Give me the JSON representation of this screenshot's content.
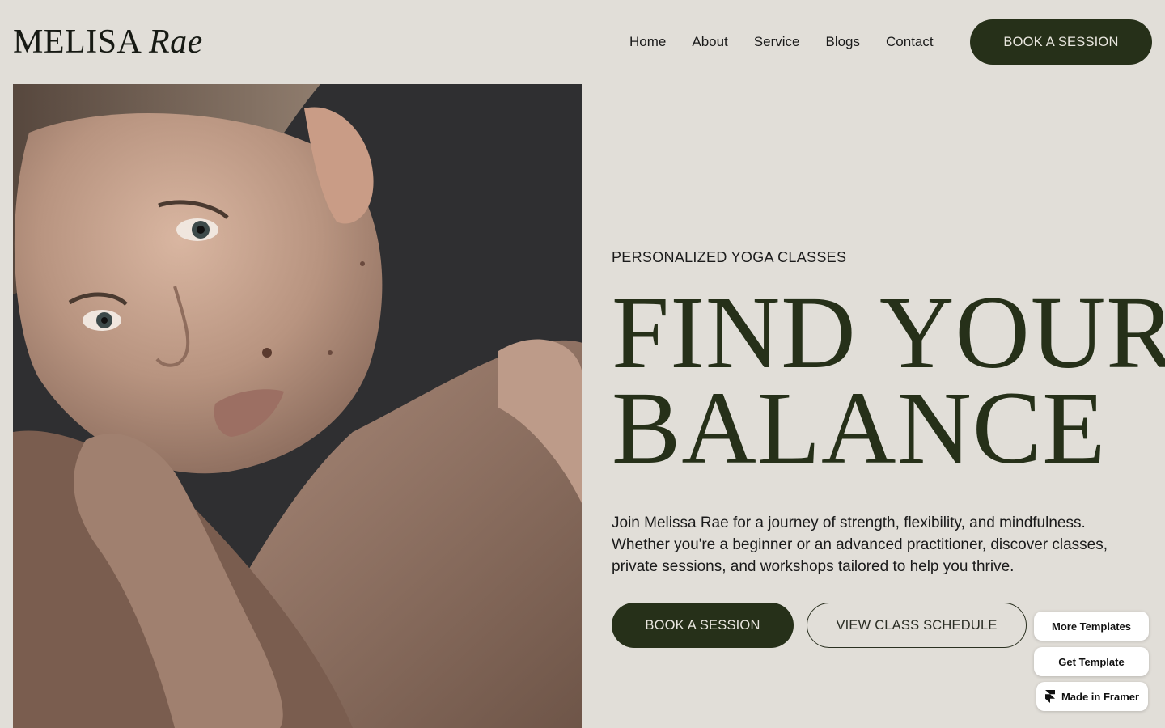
{
  "brand": {
    "name_regular": "MELISA",
    "name_italic": "Rae"
  },
  "nav": {
    "items": [
      {
        "label": "Home"
      },
      {
        "label": "About"
      },
      {
        "label": "Service"
      },
      {
        "label": "Blogs"
      },
      {
        "label": "Contact"
      }
    ],
    "cta_label": "BOOK A SESSION"
  },
  "hero": {
    "image_icon": "portrait-photo",
    "kicker": "PERSONALIZED YOGA CLASSES",
    "headline_line1": "FIND YOUR",
    "headline_line2": "BALANCE",
    "lead": "Join Melissa Rae for a journey of strength, flexibility, and mindfulness. Whether you're a beginner or an advanced practitioner, discover classes, private sessions, and workshops tailored to help you thrive.",
    "primary_cta": "BOOK A SESSION",
    "secondary_cta": "VIEW CLASS SCHEDULE"
  },
  "framer_badges": {
    "more_templates": "More Templates",
    "get_template": "Get Template",
    "made_in": "Made in Framer"
  },
  "colors": {
    "background": "#e1ded8",
    "accent_dark_green": "#263019",
    "text": "#1a1a1a"
  }
}
